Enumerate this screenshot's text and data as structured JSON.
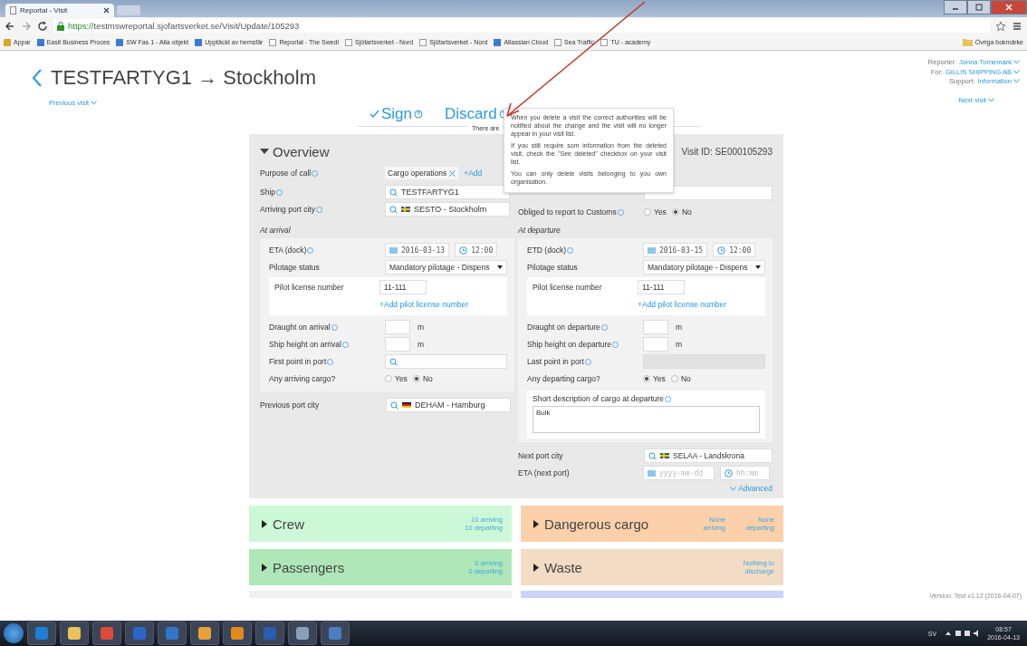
{
  "browser": {
    "tab_title": "Reportal - Visit",
    "url_scheme": "https://",
    "url_rest": "testmswreportal.sjofartsverket.se/Visit/Update/105293",
    "bookmarks": [
      {
        "label": "Appar",
        "kind": "grid"
      },
      {
        "label": "Easit Business Proces",
        "kind": "logo"
      },
      {
        "label": "SW Fas 1 - Alla objekt",
        "kind": "logo"
      },
      {
        "label": "Upptäckt av hemsfär",
        "kind": "logo"
      },
      {
        "label": "Reportal - The Swedi",
        "kind": "page"
      },
      {
        "label": "Sjöfartsverket - Nord",
        "kind": "page"
      },
      {
        "label": "Sjöfartsverket - Nord",
        "kind": "page"
      },
      {
        "label": "Atlassian Cloud",
        "kind": "logo"
      },
      {
        "label": "Sea Traffic",
        "kind": "page"
      },
      {
        "label": "TU - academy",
        "kind": "page"
      }
    ],
    "other_bookmarks": "Övriga bokmärke"
  },
  "header": {
    "title": "TESTFARTYG1 → Stockholm",
    "previous_visit": "Previous visit",
    "next_visit": "Next visit",
    "user_info": [
      {
        "label": "Reporter:",
        "value": "Jonna Tornemark"
      },
      {
        "label": "For:",
        "value": "GILLIS SHIPPING AB"
      },
      {
        "label": "Support:",
        "value": "Information"
      }
    ]
  },
  "actions": [
    {
      "label": "Sign",
      "kind": "check"
    },
    {
      "label": "Discard",
      "kind": "plain"
    }
  ],
  "action_note": "There are",
  "tooltip": [
    "When you delete a visit the correct authorities will be notified about the change and the visit will no longer appear in your visit list.",
    "If you still require som information from the deleted visit, check the \"See deleted\" checkbox on your visit list.",
    "You can only delete visits belonging to you own organisation."
  ],
  "overview": {
    "title": "Overview",
    "visit_id": "Visit ID: SE000105293",
    "purpose": {
      "label": "Purpose of call",
      "tag": "Cargo operations",
      "add": "+Add"
    },
    "ship": {
      "label": "Ship",
      "value": "TESTFARTYG1"
    },
    "arriving_port": {
      "label": "Arriving port city",
      "value": "SESTO - Stockholm"
    },
    "customs": {
      "label": "Obliged to report to Customs",
      "options": [
        {
          "label": "Yes",
          "selected": false
        },
        {
          "label": "No",
          "selected": true
        }
      ]
    },
    "panels": [
      {
        "heading": "At arrival",
        "eta": {
          "label": "ETA (dock)",
          "date": "2016-03-13",
          "time": "12:00"
        },
        "pilotage": {
          "label": "Pilotage status",
          "value": "Mandatory pilotage - Dispens"
        },
        "pilot_license": {
          "label": "Pilot license number",
          "value": "11-111",
          "add": "+Add pilot license number"
        },
        "draught": {
          "label": "Draught on arrival",
          "unit": "m"
        },
        "height": {
          "label": "Ship height on arrival",
          "unit": "m"
        },
        "point": {
          "label": "First point in port",
          "disabled": false
        },
        "cargo": {
          "label": "Any arriving cargo?",
          "options": [
            {
              "label": "Yes",
              "selected": false
            },
            {
              "label": "No",
              "selected": true
            }
          ]
        }
      },
      {
        "heading": "At departure",
        "eta": {
          "label": "ETD (dock)",
          "date": "2016-03-15",
          "time": "12:00"
        },
        "pilotage": {
          "label": "Pilotage status",
          "value": "Mandatory pilotage - Dispens"
        },
        "pilot_license": {
          "label": "Pilot license number",
          "value": "11-111",
          "add": "+Add pilot license number"
        },
        "draught": {
          "label": "Draught on departure",
          "unit": "m"
        },
        "height": {
          "label": "Ship height on departure",
          "unit": "m"
        },
        "point": {
          "label": "Last point in port",
          "disabled": true
        },
        "cargo": {
          "label": "Any departing cargo?",
          "options": [
            {
              "label": "Yes",
              "selected": true
            },
            {
              "label": "No",
              "selected": false
            }
          ]
        },
        "description": {
          "label": "Short description of cargo at departure",
          "value": "Bulk"
        }
      }
    ],
    "previous_port": {
      "label": "Previous port city",
      "value": "DEHAM - Hamburg"
    },
    "next_port": {
      "label": "Next port city",
      "value": "SELAA - Landskrona"
    },
    "eta_next": {
      "label": "ETA (next port)",
      "date_placeholder": "yyyy-mm-dd",
      "time_placeholder": "hh:mm"
    },
    "advanced": "Advanced"
  },
  "sections": [
    {
      "title": "Crew",
      "color": "#cdf8d7",
      "notes": [
        [
          "10 arriving",
          "10 departing"
        ]
      ]
    },
    {
      "title": "Dangerous cargo",
      "color": "#fbd0aa",
      "notes": [
        [
          "None arriving"
        ],
        [
          "None departing"
        ]
      ]
    },
    {
      "title": "Passengers",
      "color": "#afe7b9",
      "notes": [
        [
          "0 arriving",
          "0 departing"
        ]
      ]
    },
    {
      "title": "Waste",
      "color": "#f2dcc5",
      "notes": [
        [
          "Nothing to discharge"
        ]
      ]
    }
  ],
  "partial_sections": [
    {
      "color": "#f1f1f1"
    },
    {
      "color": "#c9d4f8"
    }
  ],
  "version": "Version: Test v1.12 (2016-04-07)",
  "taskbar": {
    "language": "SV",
    "time": "08:57",
    "date": "2016-04-13"
  }
}
